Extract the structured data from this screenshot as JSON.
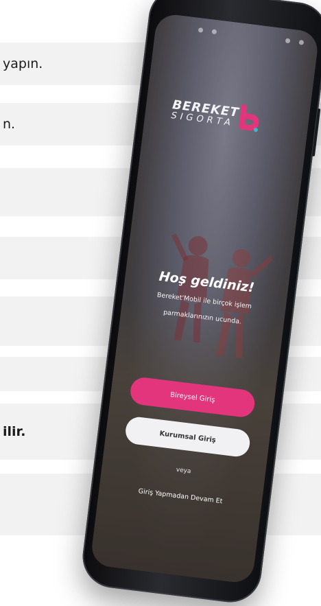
{
  "background_rows": [
    {
      "text": "yapın."
    },
    {
      "text": "n."
    },
    {
      "text": ""
    },
    {
      "text": ""
    },
    {
      "text": ""
    },
    {
      "text": ""
    },
    {
      "text": "ilir."
    }
  ],
  "app": {
    "logo": {
      "line1": "BEREKET",
      "line2": "SIGORTA",
      "mark_color": "#e3357c"
    },
    "welcome": {
      "title": "Hoş geldiniz!",
      "line1": "Bereket'Mobil ile birçok işlem",
      "line2": "parmaklarınızın ucunda."
    },
    "buttons": {
      "individual_login": "Bireysel Giriş",
      "corporate_login": "Kurumsal Giriş"
    },
    "or_text": "veya",
    "guest_link": "Giriş Yapmadan Devam Et"
  },
  "colors": {
    "accent": "#e3357c",
    "secondary_button": "#f1f1f3"
  }
}
